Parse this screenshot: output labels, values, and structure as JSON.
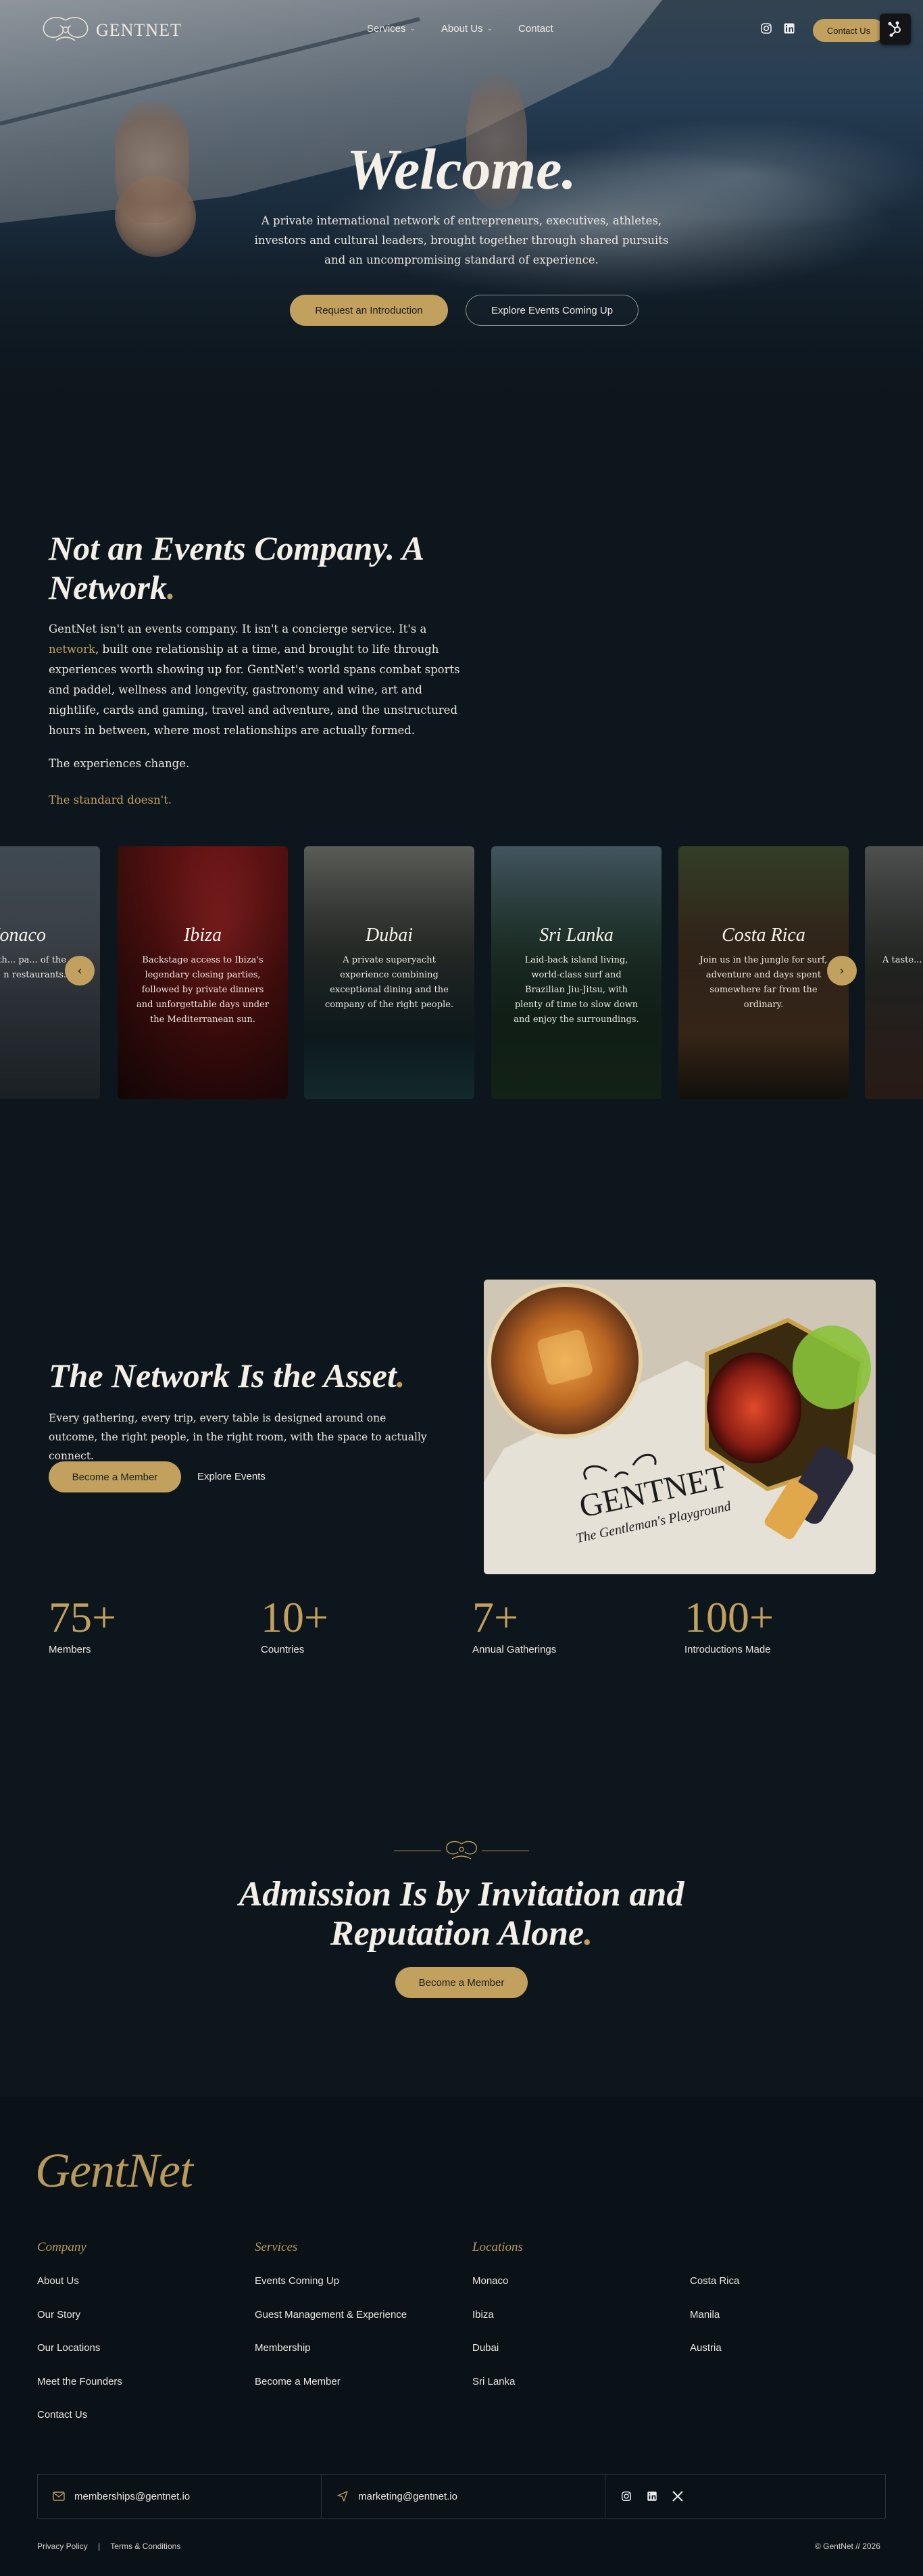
{
  "nav": {
    "brand": "GENTNET",
    "links": [
      "Services",
      "About Us",
      "Contact"
    ],
    "contact_button": "Contact Us"
  },
  "hero": {
    "title": "Welcome.",
    "subtitle": "A private international network of entrepreneurs, executives, athletes, investors and cultural leaders, brought together through shared pursuits and an uncompromising standard of experience.",
    "primary_button": "Request an Introduction",
    "secondary_button": "Explore Events Coming Up"
  },
  "network": {
    "title": "Not an Events Company. A Network",
    "title_dot": ".",
    "body_pre": "GentNet isn't an events company. It isn't a concierge service. It's a ",
    "body_link": "network",
    "body_post": ", built one relationship at a time, and brought to life through experiences worth showing up for.  GentNet's world spans combat sports and paddel, wellness and longevity, gastronomy and wine, art and nightlife, cards and gaming, travel and adventure, and the unstructured hours in between, where most relationships are actually formed.",
    "change": "The experiences change.",
    "standard": "The standard doesn't."
  },
  "carousel": {
    "cards": [
      {
        "title": "Monaco",
        "text": "...rial for th... pa... of the South o... n restaurants."
      },
      {
        "title": "Ibiza",
        "text": "Backstage access to Ibiza's legendary closing parties, followed by private dinners and unforgettable days under the Mediterranean sun."
      },
      {
        "title": "Dubai",
        "text": "A private superyacht experience combining exceptional dining and the company of the right people."
      },
      {
        "title": "Sri Lanka",
        "text": "Laid-back island living, world-class surf and Brazilian Jiu-Jitsu, with plenty of time to slow down and enjoy the surroundings."
      },
      {
        "title": "Costa Rica",
        "text": "Join us in the jungle for surf, adventure and days spent somewhere far from the ordinary."
      },
      {
        "title": "",
        "text": "A taste..."
      }
    ],
    "prev": "‹",
    "next": "›"
  },
  "asset": {
    "title": "The Network Is the Asset",
    "body": "Every gathering, every trip, every table is designed around one outcome, the right people, in the right room, with the space to actually connect.",
    "button": "Become a Member",
    "link": "Explore Events",
    "image_caption": "GENTNET",
    "image_tagline": "The Gentleman's Playground"
  },
  "stats": [
    {
      "value": "75+",
      "label": "Members"
    },
    {
      "value": "10+",
      "label": "Countries"
    },
    {
      "value": "7+",
      "label": "Annual Gatherings"
    },
    {
      "value": "100+",
      "label": "Introductions Made"
    }
  ],
  "admission": {
    "title_line1": "Admission Is by Invitation and",
    "title_line2": "Reputation Alone",
    "button": "Become a Member"
  },
  "footer": {
    "logo": "GentNet",
    "company": {
      "heading": "Company",
      "items": [
        "About Us",
        "Our Story",
        "Our Locations",
        "Meet the Founders",
        "Contact Us"
      ]
    },
    "services": {
      "heading": "Services",
      "items": [
        "Events Coming Up",
        "Guest Management & Experience",
        "Membership",
        "Become a Member"
      ]
    },
    "locations": {
      "heading": "Locations",
      "items_a": [
        "Monaco",
        "Ibiza",
        "Dubai",
        "Sri Lanka"
      ],
      "items_b": [
        "Costa Rica",
        "Manila",
        "Austria"
      ]
    },
    "email_memberships": "memberships@gentnet.io",
    "email_marketing": "marketing@gentnet.io",
    "privacy": "Privacy Policy",
    "separator": "|",
    "terms": "Terms & Conditions",
    "copyright": "© GentNet // 2026"
  },
  "colors": {
    "accent": "#c2a15f",
    "background": "#0d161c",
    "footer": "#0a1117"
  }
}
